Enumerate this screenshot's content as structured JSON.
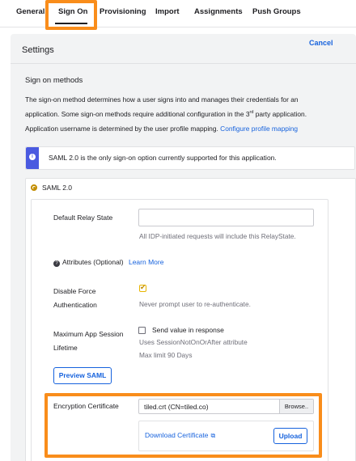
{
  "tabs": [
    {
      "label": "General"
    },
    {
      "label": "Sign On"
    },
    {
      "label": "Provisioning"
    },
    {
      "label": "Import"
    },
    {
      "label": "Assignments"
    },
    {
      "label": "Push Groups"
    }
  ],
  "active_tab": "Sign On",
  "settings": {
    "title": "Settings",
    "cancel_label": "Cancel"
  },
  "sign_on_methods": {
    "title": "Sign on methods",
    "paragraph_line1": "The sign-on method determines how a user signs into and manages their credentials for an",
    "paragraph_line2_pre": "application. Some sign-on methods require additional configuration in the 3",
    "paragraph_line2_sup": "rd",
    "paragraph_line2_post": " party application.",
    "username_text": "Application username is determined by the user profile mapping.",
    "configure_link": "Configure profile mapping"
  },
  "info_banner": {
    "text": "SAML 2.0 is the only sign-on option currently supported for this application."
  },
  "saml": {
    "option_label": "SAML 2.0",
    "selected": true,
    "default_relay_state": {
      "label": "Default Relay State",
      "value": "",
      "help": "All IDP-initiated requests will include this RelayState."
    },
    "attributes": {
      "label": "Attributes (Optional)",
      "link": "Learn More"
    },
    "disable_force_auth": {
      "label_line1": "Disable Force",
      "label_line2": "Authentication",
      "checked": true,
      "help": "Never prompt user to re-authenticate."
    },
    "max_session": {
      "label_line1": "Maximum App Session",
      "label_line2": "Lifetime",
      "checkbox_label": "Send value in response",
      "checked": false,
      "help1": "Uses SessionNotOnOrAfter attribute",
      "help2": "Max limit 90 Days"
    },
    "preview_button": "Preview SAML",
    "encryption_certificate": {
      "label": "Encryption Certificate",
      "file_value": "tiled.crt (CN=tiled.co)",
      "browse_label": "Browse..",
      "download_link": "Download Certificate",
      "upload_button": "Upload"
    }
  },
  "colors": {
    "accent": "#1662dd",
    "highlight": "#f98d1b",
    "info_stripe": "#4a5ae0",
    "check": "#c28d00"
  }
}
